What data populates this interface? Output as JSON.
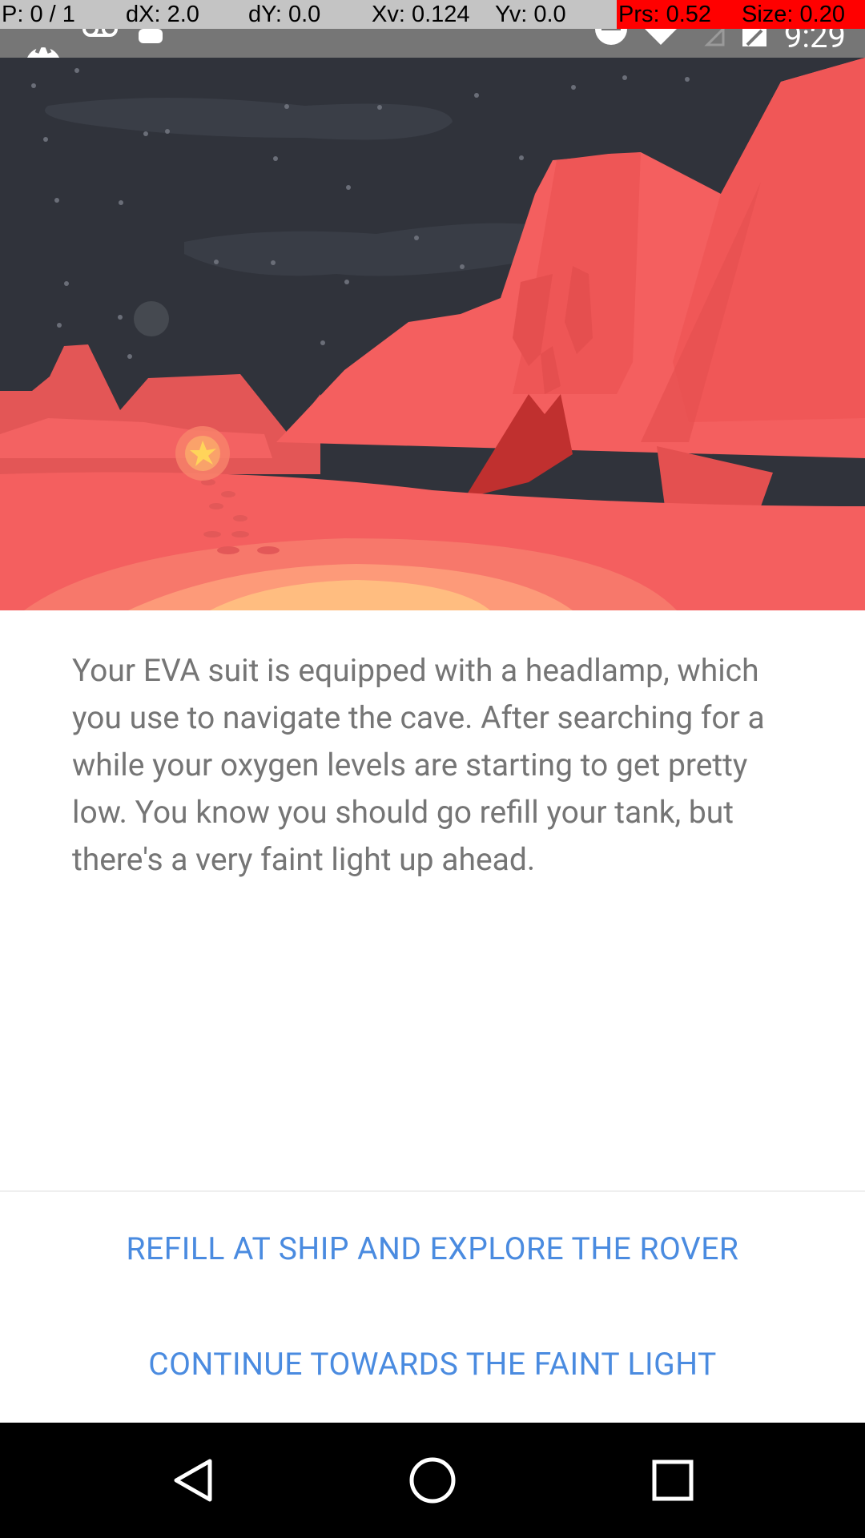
{
  "debug_overlay": {
    "pointer": "P: 0 / 1",
    "dx": "dX: 2.0",
    "dy": "dY: 0.0",
    "xv": "Xv: 0.124",
    "yv": "Yv: 0.0",
    "prs": "Prs: 0.52",
    "size": "Size: 0.20"
  },
  "status_bar": {
    "time": "9:29",
    "icons_left": [
      "app-icon",
      "voicemail-icon",
      "android-icon"
    ],
    "icons_right": [
      "do-not-disturb-icon",
      "wifi-icon",
      "signal-icon",
      "battery-icon"
    ]
  },
  "story": {
    "text": "Your EVA suit is equipped with a headlamp, which you use to navigate the cave. After searching for a while your oxygen levels are starting to get pretty low. You know you should go refill your tank, but there's a very faint light up ahead."
  },
  "choices": {
    "first": "REFILL AT SHIP AND EXPLORE THE ROVER",
    "second": "CONTINUE TOWARDS THE FAINT LIGHT"
  },
  "colors": {
    "choice_text": "#4a8be0",
    "story_text": "#757575",
    "sky": "#30333b",
    "rock": "#f45f5f",
    "glow": "#ffbd80"
  }
}
